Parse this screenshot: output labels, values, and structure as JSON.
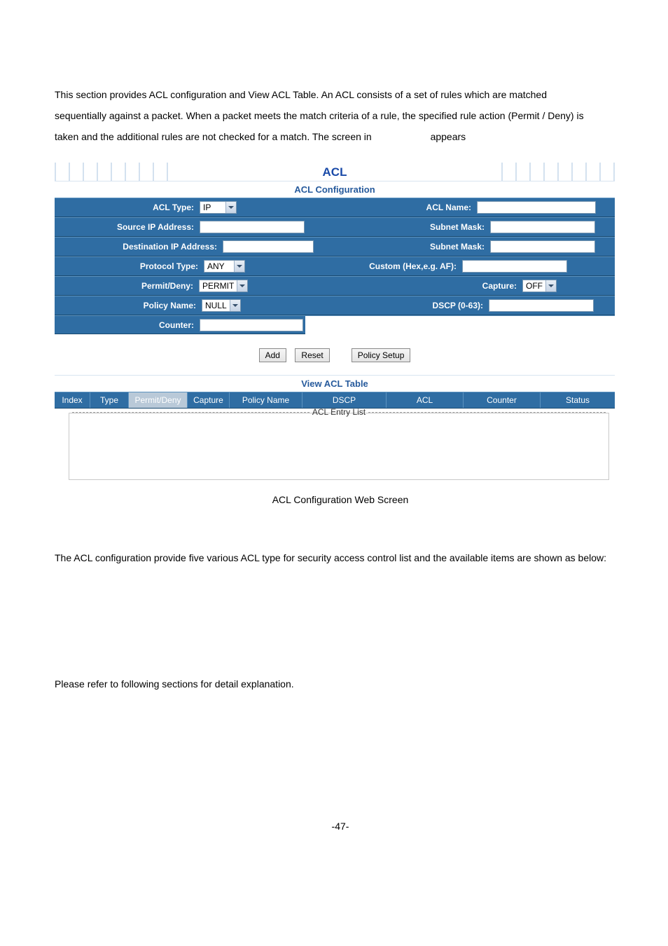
{
  "intro": {
    "line1": "This section provides ACL configuration and View ACL Table. An ACL consists of a set of rules which are matched",
    "line2": "sequentially against a packet. When a packet meets the match criteria of a rule, the specified rule action (Permit / Deny) is",
    "line3a": "taken and the additional rules are not checked for a match. The screen in",
    "line3b": "appears"
  },
  "panel": {
    "title": "ACL",
    "config_head": "ACL Configuration",
    "rows": {
      "acl_type_label": "ACL Type:",
      "acl_type_value": "IP",
      "acl_name_label": "ACL Name:",
      "acl_name_value": "",
      "src_ip_label": "Source IP Address:",
      "src_ip_value": "",
      "src_mask_label": "Subnet Mask:",
      "src_mask_value": "",
      "dst_ip_label": "Destination IP Address:",
      "dst_ip_value": "",
      "dst_mask_label": "Subnet Mask:",
      "dst_mask_value": "",
      "proto_label": "Protocol Type:",
      "proto_value": "ANY",
      "custom_label": "Custom (Hex,e.g. AF):",
      "custom_value": "",
      "permit_label": "Permit/Deny:",
      "permit_value": "PERMIT",
      "capture_label": "Capture:",
      "capture_value": "OFF",
      "policy_label": "Policy Name:",
      "policy_value": "NULL",
      "dscp_label": "DSCP (0-63):",
      "dscp_value": "",
      "counter_label": "Counter:",
      "counter_value": ""
    },
    "buttons": {
      "add": "Add",
      "reset": "Reset",
      "policy_setup": "Policy Setup"
    },
    "table_head": "View ACL Table",
    "columns": {
      "index": "Index",
      "type": "Type",
      "permit": "Permit/Deny",
      "capture": "Capture",
      "policy": "Policy Name",
      "dscp": "DSCP",
      "acl": "ACL",
      "counter": "Counter",
      "status": "Status"
    },
    "entry_legend": "ACL Entry List"
  },
  "caption": "ACL Configuration Web Screen",
  "bodytext": "The ACL configuration provide five various ACL type for security access control list and the available items are shown as below:",
  "bodytext2": "Please refer to following sections for detail explanation.",
  "pagenum": "-47-"
}
